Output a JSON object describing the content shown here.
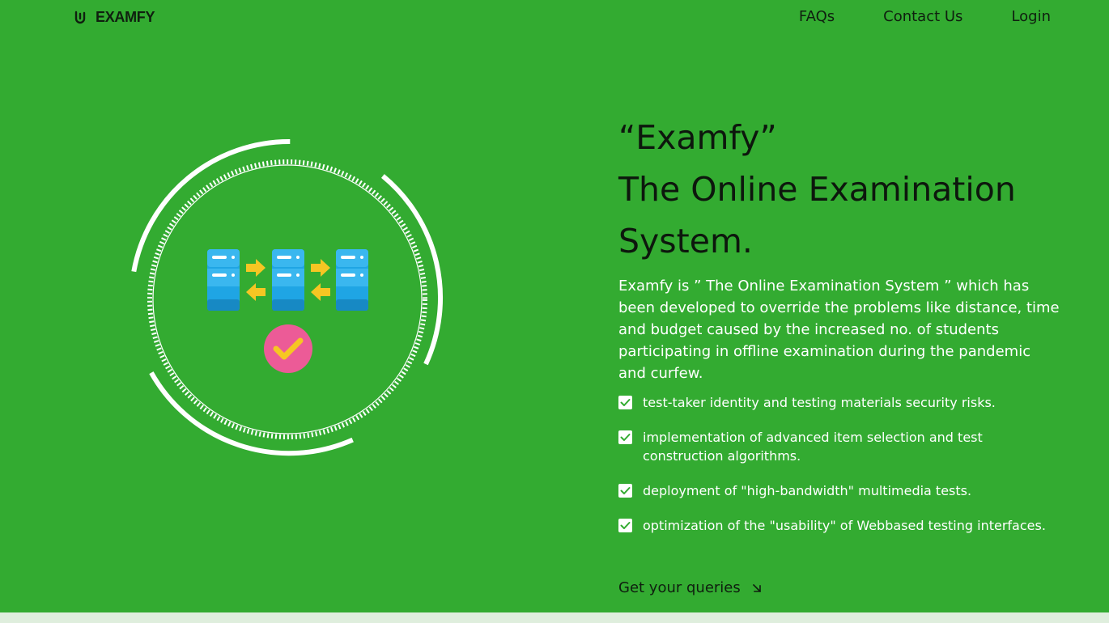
{
  "header": {
    "brand": "EXAMFY",
    "brand_icon": "paperclip-logo-icon",
    "nav": [
      {
        "label": "FAQs"
      },
      {
        "label": "Contact Us"
      },
      {
        "label": "Login"
      }
    ]
  },
  "hero": {
    "headline_line1": "“Examfy”",
    "headline_line2": "The Online Examination",
    "headline_line3": "System.",
    "intro": "Examfy is ” The Online Examination System ” which has been developed to override the problems like distance, time and budget caused by the increased no. of students participating in offline examination during the pandemic and curfew.",
    "features": [
      "test-taker identity and testing materials security risks.",
      "implementation of advanced item selection and test construction algorithms.",
      "deployment of \"high-bandwidth\" multimedia tests.",
      "optimization of the \"usability\" of Webbased testing interfaces."
    ],
    "feature_icon": "checkbox-checked-icon",
    "cta_label": "Get your queries",
    "cta_icon": "arrow-down-right-icon"
  },
  "illustration": {
    "icon": "server-sync-illustration",
    "check_icon": "check-badge-icon"
  },
  "colors": {
    "background": "#33ab31",
    "text_dark": "#0d170d",
    "text_light": "#ffffff",
    "server_blue": "#1fa5e4",
    "arrow_yellow": "#f6c623",
    "badge_pink": "#ec5b97",
    "bottom_strip": "#dfeedd"
  }
}
